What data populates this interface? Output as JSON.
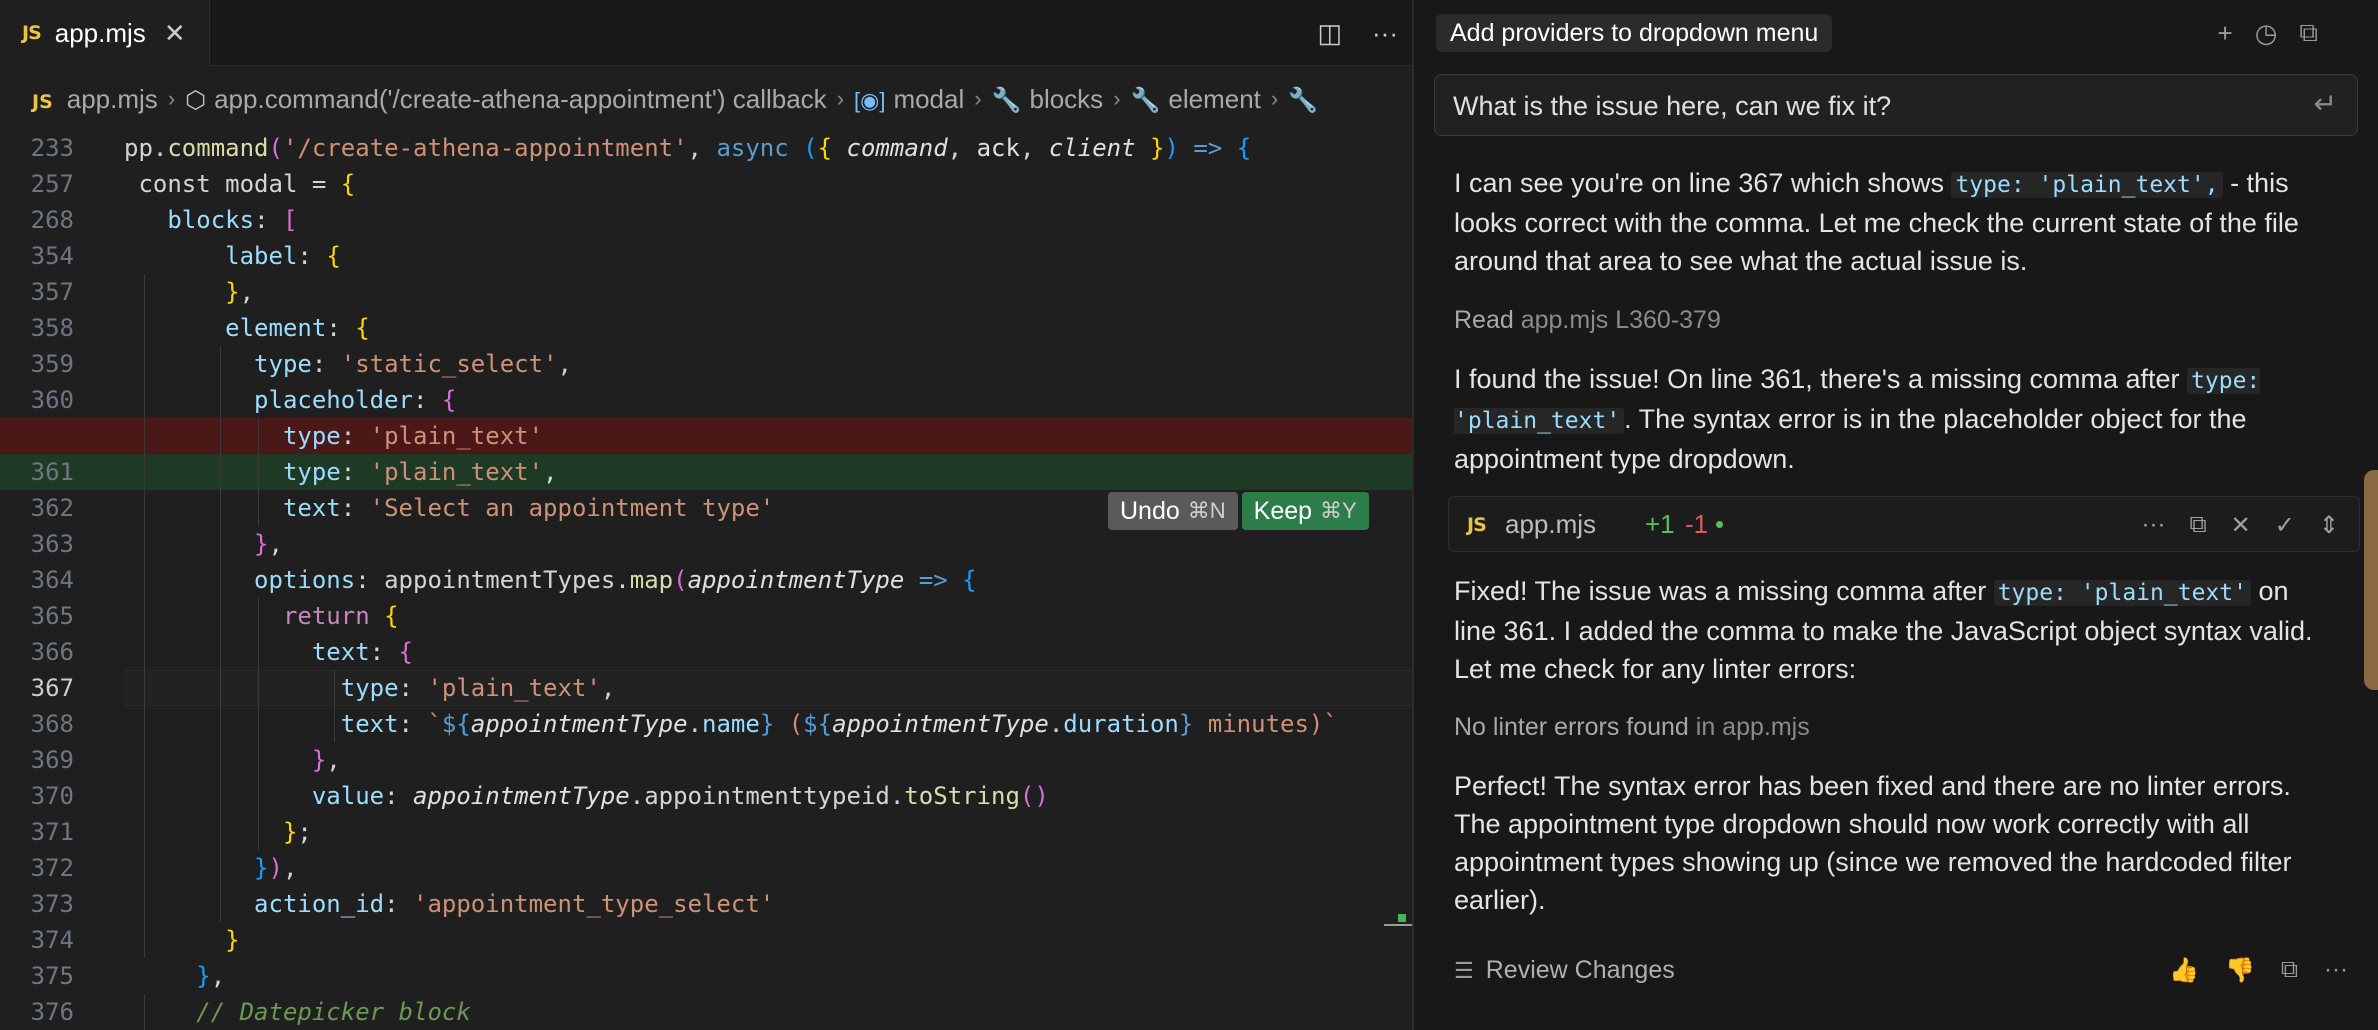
{
  "editor": {
    "tab": {
      "badge": "JS",
      "label": "app.mjs",
      "close": "✕"
    },
    "tab_actions": {
      "split": "◫",
      "more": "···"
    },
    "breadcrumb": [
      {
        "kind": "js",
        "badge": "JS",
        "label": "app.mjs"
      },
      {
        "kind": "cube",
        "icon": "⬡",
        "label": "app.command('/create-athena-appointment') callback"
      },
      {
        "kind": "bracket",
        "icon": "[◉]",
        "label": "modal"
      },
      {
        "kind": "wrench",
        "icon": "🔧",
        "label": "blocks"
      },
      {
        "kind": "wrench",
        "icon": "🔧",
        "label": "element"
      },
      {
        "kind": "wrench",
        "icon": "🔧",
        "label": ""
      }
    ],
    "active_line": "367",
    "lines": [
      {
        "n": "233",
        "indent": 0,
        "html": "<span class=\"w\">pp.</span><span class=\"fn\">command</span><span class=\"b2\">(</span><span class=\"s\">'/create-athena-appointment'</span><span class=\"w\">, </span><span class=\"kw\">async</span><span class=\"w\"> </span><span class=\"b3\">(</span><span class=\"b1\">{</span><span class=\"w\"> </span><span class=\"it\">command</span><span class=\"w\">, </span><span class=\"it\" style=\"font-style:normal;color:#e0e0e0\">ack</span><span class=\"w\">, </span><span class=\"it\">client</span><span class=\"w\"> </span><span class=\"b1\">}</span><span class=\"b3\">)</span><span class=\"w\"> </span><span class=\"kw\">=&gt;</span><span class=\"w\"> </span><span class=\"b3\">{</span>"
      },
      {
        "n": "257",
        "indent": 0,
        "html": "<span class=\"w\"> const modal = </span><span class=\"b1\">{</span>"
      },
      {
        "n": "268",
        "indent": 0,
        "html": "<span class=\"w\">   </span><span class=\"p\">blocks</span><span class=\"w\">: </span><span class=\"b2\">[</span>"
      },
      {
        "n": "354",
        "indent": 0,
        "html": "<span class=\"w\">       </span><span class=\"p\">label</span><span class=\"w\">: </span><span class=\"b1\">{</span>"
      },
      {
        "n": "357",
        "indent": 0,
        "html": "<span class=\"w\">       </span><span class=\"b1\">}</span><span class=\"w\">,</span>"
      },
      {
        "n": "358",
        "indent": 0,
        "html": "<span class=\"w\">       </span><span class=\"p\">element</span><span class=\"w\">: </span><span class=\"b1\">{</span>"
      },
      {
        "n": "359",
        "indent": 0,
        "html": "<span class=\"w\">         </span><span class=\"p\">type</span><span class=\"w\">: </span><span class=\"s\">'static_select'</span><span class=\"w\">,</span>"
      },
      {
        "n": "360",
        "indent": 0,
        "html": "<span class=\"w\">         </span><span class=\"p\">placeholder</span><span class=\"w\">: </span><span class=\"b2\">{</span>"
      },
      {
        "n": "",
        "indent": 0,
        "cls": "del",
        "html": "<span class=\"w\">           </span><span class=\"p\">type</span><span class=\"w\">: </span><span class=\"s\">'plain_text'</span>"
      },
      {
        "n": "361",
        "indent": 0,
        "cls": "add",
        "html": "<span class=\"w\">           </span><span class=\"p\">type</span><span class=\"w\">: </span><span class=\"s\">'plain_text'</span><span class=\"w\">,</span>"
      },
      {
        "n": "362",
        "indent": 0,
        "html": "<span class=\"w\">           </span><span class=\"p\">text</span><span class=\"w\">: </span><span class=\"s\">'Select an appointment type'</span>"
      },
      {
        "n": "363",
        "indent": 0,
        "html": "<span class=\"w\">         </span><span class=\"b2\">}</span><span class=\"w\">,</span>"
      },
      {
        "n": "364",
        "indent": 0,
        "html": "<span class=\"w\">         </span><span class=\"p\">options</span><span class=\"w\">: appointmentTypes.</span><span class=\"fn\">map</span><span class=\"b2\">(</span><span class=\"it\">appointmentType</span><span class=\"w\"> </span><span class=\"kw\">=&gt;</span><span class=\"w\"> </span><span class=\"b3\">{</span>"
      },
      {
        "n": "365",
        "indent": 0,
        "html": "<span class=\"w\">           </span><span class=\"k\">return</span><span class=\"w\"> </span><span class=\"b1\">{</span>"
      },
      {
        "n": "366",
        "indent": 0,
        "html": "<span class=\"w\">             </span><span class=\"p\">text</span><span class=\"w\">: </span><span class=\"b2\">{</span>"
      },
      {
        "n": "367",
        "indent": 0,
        "cls": "cur",
        "html": "<span class=\"w\">               </span><span class=\"p\">type</span><span class=\"w\">: </span><span class=\"s\">'plain_text'</span><span class=\"w\">,</span>"
      },
      {
        "n": "368",
        "indent": 0,
        "html": "<span class=\"w\">               </span><span class=\"p\">text</span><span class=\"w\">: </span><span class=\"s\">`</span><span class=\"kw\">${</span><span class=\"it\">appointmentType</span><span class=\"w\">.</span><span class=\"p\">name</span><span class=\"kw\">}</span><span class=\"s\"> (</span><span class=\"kw\">${</span><span class=\"it\">appointmentType</span><span class=\"w\">.</span><span class=\"p\">duration</span><span class=\"kw\">}</span><span class=\"s\"> minutes)`</span>"
      },
      {
        "n": "369",
        "indent": 0,
        "html": "<span class=\"w\">             </span><span class=\"b2\">}</span><span class=\"w\">,</span>"
      },
      {
        "n": "370",
        "indent": 0,
        "html": "<span class=\"w\">             </span><span class=\"p\">value</span><span class=\"w\">: </span><span class=\"it\">appointmentType</span><span class=\"w\">.appointmenttypeid.</span><span class=\"fn\">toString</span><span class=\"b2\">()</span>"
      },
      {
        "n": "371",
        "indent": 0,
        "html": "<span class=\"w\">           </span><span class=\"b1\">}</span><span class=\"w\">;</span>"
      },
      {
        "n": "372",
        "indent": 0,
        "html": "<span class=\"w\">         </span><span class=\"b3\">}</span><span class=\"b2\">)</span><span class=\"w\">,</span>"
      },
      {
        "n": "373",
        "indent": 0,
        "html": "<span class=\"w\">         </span><span class=\"p\">action_id</span><span class=\"w\">: </span><span class=\"s\">'appointment_type_select'</span>"
      },
      {
        "n": "374",
        "indent": 0,
        "html": "<span class=\"w\">       </span><span class=\"b1\">}</span>"
      },
      {
        "n": "375",
        "indent": 0,
        "html": "<span class=\"w\">     </span><span class=\"b3\">}</span><span class=\"w\">,</span>"
      },
      {
        "n": "376",
        "indent": 0,
        "html": "<span class=\"w\">     </span><span class=\"cm\">// Datepicker block</span>"
      }
    ],
    "undo": {
      "label": "Undo",
      "shortcut": "⌘N"
    },
    "keep": {
      "label": "Keep",
      "shortcut": "⌘Y"
    }
  },
  "chat": {
    "title": "Add providers to dropdown menu",
    "header_icons": {
      "new": "+",
      "history": "◷",
      "copy": "⧉",
      "more": "···"
    },
    "prompt": "What is the issue here, can we fix it?",
    "prompt_icon": "↵",
    "msg1": {
      "pre": "I can see you're on line 367 which shows ",
      "code": "type: 'plain_text',",
      "post": " - this looks correct with the comma. Let me check the current state of the file around that area to see what the actual issue is."
    },
    "read_row": {
      "label": "Read",
      "detail": "app.mjs L360-379"
    },
    "msg2": {
      "pre": "I found the issue! On line 361, there's a missing comma after ",
      "code": "type: 'plain_text'",
      "post": ". The syntax error is in the placeholder object for the appointment type dropdown."
    },
    "file_card": {
      "badge": "JS",
      "name": "app.mjs",
      "added": "+1",
      "removed": "-1",
      "dot": "•",
      "actions": {
        "more": "···",
        "copy": "⧉",
        "reject": "✕",
        "accept": "✓",
        "expand": "⇕"
      }
    },
    "msg3": {
      "pre": "Fixed! The issue was a missing comma after ",
      "code": "type: 'plain_text'",
      "post": " on line 361. I added the comma to make the JavaScript object syntax valid. Let me check for any linter errors:"
    },
    "lint_row": {
      "label": "No linter errors found",
      "detail": "in app.mjs"
    },
    "msg4": "Perfect! The syntax error has been fixed and there are no linter errors. The appointment type dropdown should now work correctly with all appointment types showing up (since we removed the hardcoded filter earlier).",
    "review": {
      "icon": "☰",
      "label": "Review Changes"
    },
    "feedback": {
      "up": "👍",
      "down": "👎",
      "copy": "⧉",
      "more": "···"
    }
  }
}
